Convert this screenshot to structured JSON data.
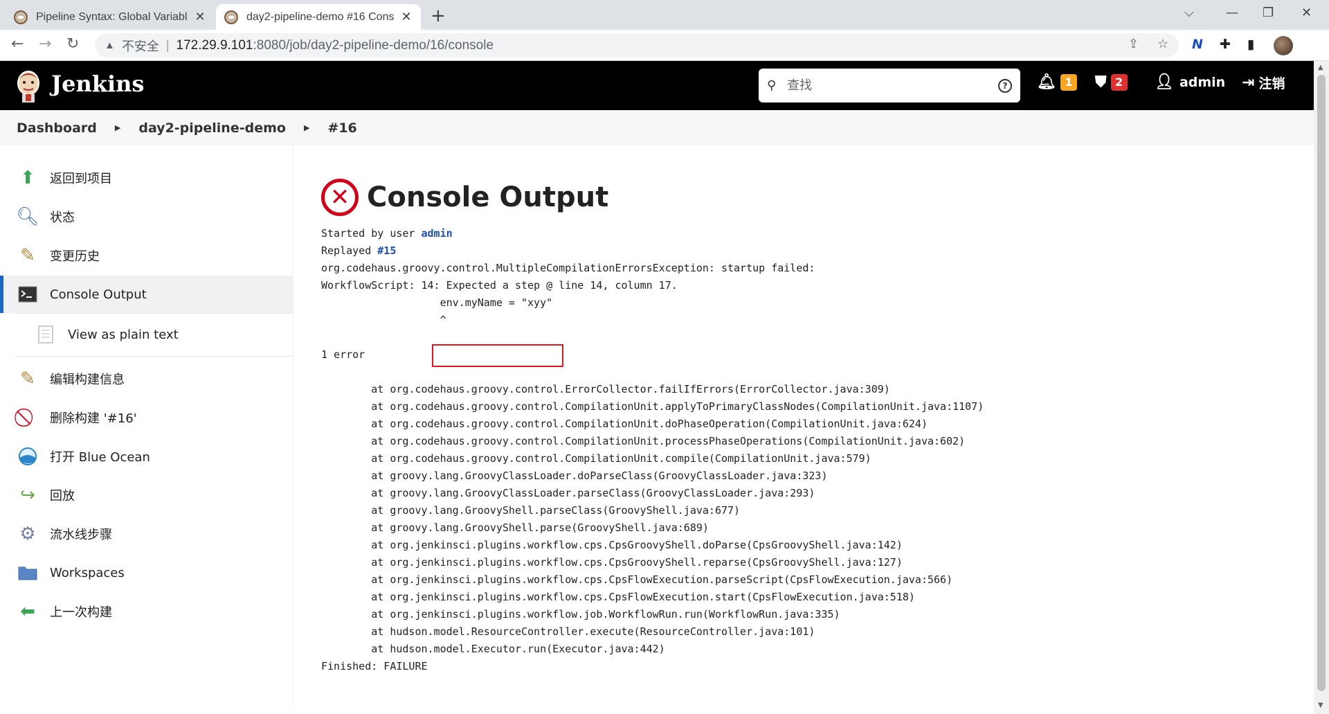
{
  "browser": {
    "tabs": [
      {
        "title": "Pipeline Syntax: Global Variabl",
        "active": false
      },
      {
        "title": "day2-pipeline-demo #16 Cons",
        "active": true
      }
    ],
    "new_tab": "+",
    "address": {
      "security": "不安全",
      "host": "172.29.9.101",
      "path": ":8080/job/day2-pipeline-demo/16/console"
    }
  },
  "header": {
    "brand": "Jenkins",
    "search_placeholder": "查找",
    "notifications_count": "1",
    "security_count": "2",
    "user": "admin",
    "logout": "注销"
  },
  "breadcrumb": [
    "Dashboard",
    "day2-pipeline-demo",
    "#16"
  ],
  "sidebar": {
    "items": [
      {
        "label": "返回到项目",
        "icon": "arrow-up-icon"
      },
      {
        "label": "状态",
        "icon": "magnifier-icon"
      },
      {
        "label": "变更历史",
        "icon": "notepad-icon"
      },
      {
        "label": "Console Output",
        "icon": "terminal-icon"
      },
      {
        "label": "View as plain text",
        "icon": "document-icon"
      },
      {
        "label": "编辑构建信息",
        "icon": "notepad-icon"
      },
      {
        "label": "删除构建 '#16'",
        "icon": "no-entry-icon"
      },
      {
        "label": "打开 Blue Ocean",
        "icon": "blue-ocean-icon"
      },
      {
        "label": "回放",
        "icon": "replay-icon"
      },
      {
        "label": "流水线步骤",
        "icon": "gear-icon"
      },
      {
        "label": "Workspaces",
        "icon": "folder-icon"
      },
      {
        "label": "上一次构建",
        "icon": "arrow-left-icon"
      }
    ]
  },
  "main": {
    "title": "Console Output",
    "started_prefix": "Started by user ",
    "started_user": "admin",
    "replayed_prefix": "Replayed ",
    "replayed_link": "#15",
    "lines_a": [
      "org.codehaus.groovy.control.MultipleCompilationErrorsException: startup failed:",
      "WorkflowScript: 14: Expected a step @ line 14, column 17.",
      "                   env.myName = \"xyy\"",
      "                   ^",
      "",
      "1 error",
      "",
      "        at org.codehaus.groovy.control.ErrorCollector.failIfErrors(ErrorCollector.java:309)",
      "        at org.codehaus.groovy.control.CompilationUnit.applyToPrimaryClassNodes(CompilationUnit.java:1107)",
      "        at org.codehaus.groovy.control.CompilationUnit.doPhaseOperation(CompilationUnit.java:624)",
      "        at org.codehaus.groovy.control.CompilationUnit.processPhaseOperations(CompilationUnit.java:602)",
      "        at org.codehaus.groovy.control.CompilationUnit.compile(CompilationUnit.java:579)",
      "        at groovy.lang.GroovyClassLoader.doParseClass(GroovyClassLoader.java:323)",
      "        at groovy.lang.GroovyClassLoader.parseClass(GroovyClassLoader.java:293)",
      "        at groovy.lang.GroovyShell.parseClass(GroovyShell.java:677)",
      "        at groovy.lang.GroovyShell.parse(GroovyShell.java:689)",
      "        at org.jenkinsci.plugins.workflow.cps.CpsGroovyShell.doParse(CpsGroovyShell.java:142)",
      "        at org.jenkinsci.plugins.workflow.cps.CpsGroovyShell.reparse(CpsGroovyShell.java:127)",
      "        at org.jenkinsci.plugins.workflow.cps.CpsFlowExecution.parseScript(CpsFlowExecution.java:566)",
      "        at org.jenkinsci.plugins.workflow.cps.CpsFlowExecution.start(CpsFlowExecution.java:518)",
      "        at org.jenkinsci.plugins.workflow.job.WorkflowRun.run(WorkflowRun.java:335)",
      "        at hudson.model.ResourceController.execute(ResourceController.java:101)",
      "        at hudson.model.Executor.run(Executor.java:442)",
      "Finished: FAILURE"
    ]
  },
  "colors": {
    "error_red": "#d0011b",
    "link_blue": "#1f4fad",
    "active_accent": "#1f67c3",
    "badge_orange": "#f6a623",
    "badge_red": "#e03131"
  }
}
